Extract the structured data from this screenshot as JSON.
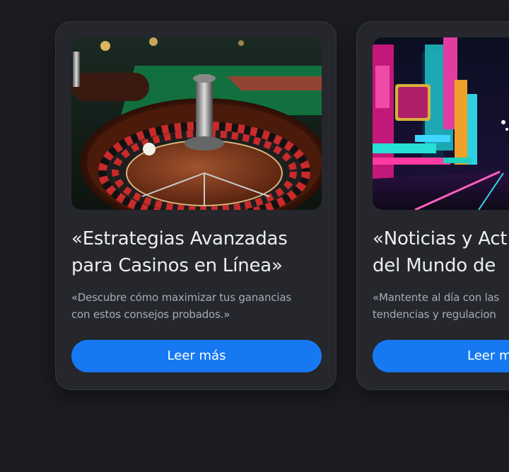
{
  "cards": [
    {
      "title": "«Estrategias Avanzadas\npara Casinos en Línea»",
      "description": "«Descubre cómo maximizar tus ganancias\ncon estos consejos probados.»",
      "button_label": "Leer más",
      "image": "roulette-wheel-image"
    },
    {
      "title": "«Noticias y Act\ndel Mundo de",
      "description": "«Mantente al día con las\ntendencias y regulacion",
      "button_label": "Leer m",
      "image": "neon-city-street-image"
    }
  ],
  "colors": {
    "background": "#1b1d22",
    "card": "#25272d",
    "accent": "#1679f2",
    "title": "#eceef2",
    "description": "#a7abb4"
  }
}
